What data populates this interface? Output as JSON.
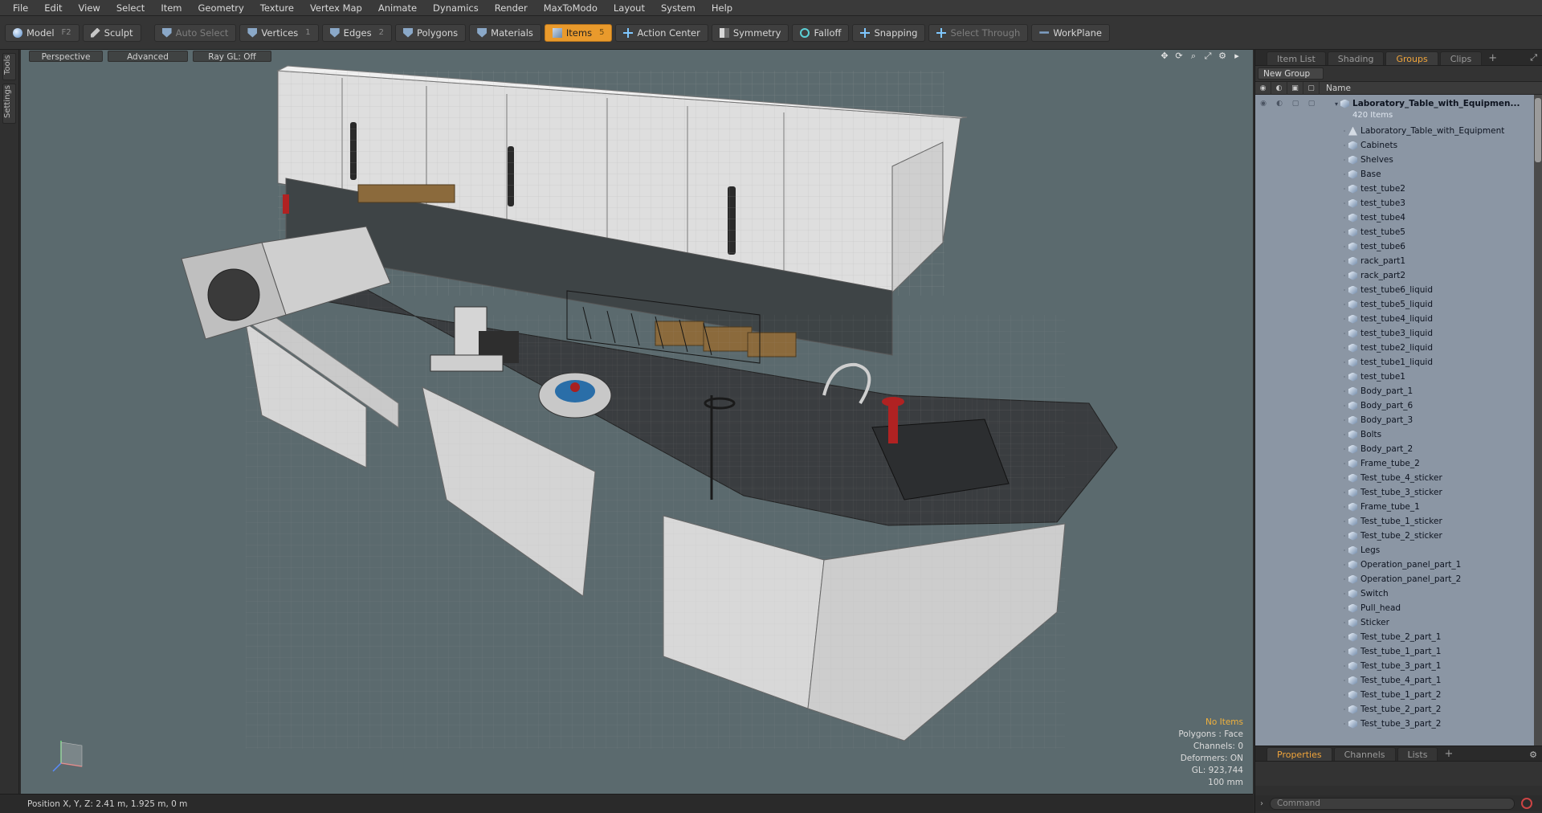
{
  "menu": [
    "File",
    "Edit",
    "View",
    "Select",
    "Item",
    "Geometry",
    "Texture",
    "Vertex Map",
    "Animate",
    "Dynamics",
    "Render",
    "MaxToModo",
    "Layout",
    "System",
    "Help"
  ],
  "toolbar": {
    "model": "Model",
    "model_key": "F2",
    "sculpt": "Sculpt",
    "auto_select": "Auto Select",
    "vertices": "Vertices",
    "vertices_key": "1",
    "edges": "Edges",
    "edges_key": "2",
    "polygons": "Polygons",
    "materials": "Materials",
    "items": "Items",
    "items_key": "5",
    "action_center": "Action Center",
    "symmetry": "Symmetry",
    "falloff": "Falloff",
    "snapping": "Snapping",
    "select_through": "Select Through",
    "workplane": "WorkPlane"
  },
  "left_strip": {
    "tools": "Tools",
    "settings": "Settings"
  },
  "viewport": {
    "perspective": "Perspective",
    "advanced": "Advanced",
    "raygl": "Ray GL: Off",
    "info": {
      "no_items": "No Items",
      "polygons": "Polygons : Face",
      "channels": "Channels: 0",
      "deformers": "Deformers: ON",
      "gl": "GL: 923,744",
      "scale": "100 mm"
    }
  },
  "right_panel": {
    "tabs": [
      "Item List",
      "Shading",
      "Groups",
      "Clips"
    ],
    "active_tab": "Groups",
    "new_group": "New Group",
    "name_header": "Name",
    "root": {
      "name": "Laboratory_Table_with_Equipmen...",
      "count": "420 Items"
    },
    "children": [
      "Laboratory_Table_with_Equipment",
      "Cabinets",
      "Shelves",
      "Base",
      "test_tube2",
      "test_tube3",
      "test_tube4",
      "test_tube5",
      "test_tube6",
      "rack_part1",
      "rack_part2",
      "test_tube6_liquid",
      "test_tube5_liquid",
      "test_tube4_liquid",
      "test_tube3_liquid",
      "test_tube2_liquid",
      "test_tube1_liquid",
      "test_tube1",
      "Body_part_1",
      "Body_part_6",
      "Body_part_3",
      "Bolts",
      "Body_part_2",
      "Frame_tube_2",
      "Test_tube_4_sticker",
      "Test_tube_3_sticker",
      "Frame_tube_1",
      "Test_tube_1_sticker",
      "Test_tube_2_sticker",
      "Legs",
      "Operation_panel_part_1",
      "Operation_panel_part_2",
      "Switch",
      "Pull_head",
      "Sticker",
      "Test_tube_2_part_1",
      "Test_tube_1_part_1",
      "Test_tube_3_part_1",
      "Test_tube_4_part_1",
      "Test_tube_1_part_2",
      "Test_tube_2_part_2",
      "Test_tube_3_part_2"
    ],
    "bottom_tabs": [
      "Properties",
      "Channels",
      "Lists"
    ],
    "bottom_active": "Properties",
    "command_placeholder": "Command"
  },
  "status": {
    "position": "Position X, Y, Z:   2.41 m, 1.925 m, 0 m"
  },
  "colors": {
    "accent": "#e99a2c",
    "viewport_bg": "#5b6a6e",
    "tree_bg": "#8b96a4"
  }
}
